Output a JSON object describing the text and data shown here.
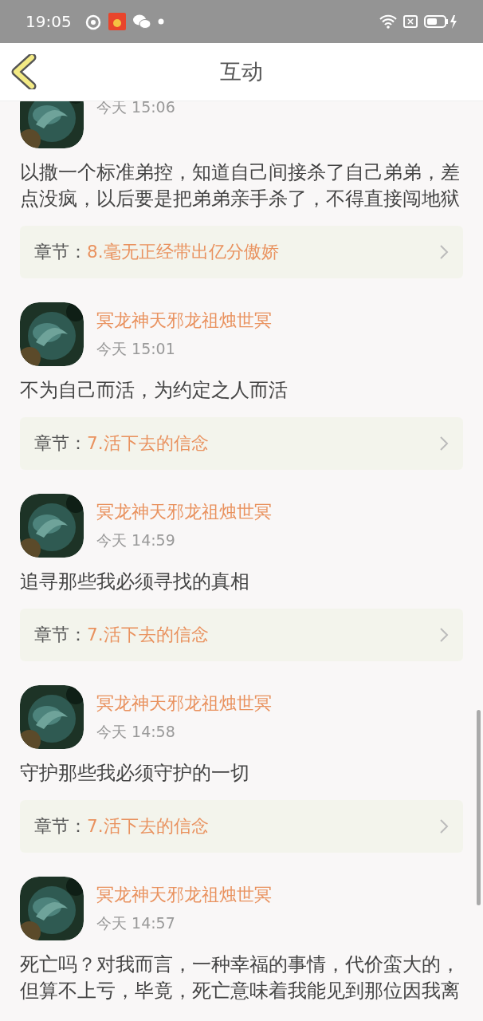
{
  "status_bar": {
    "time": "19:05"
  },
  "header": {
    "title": "互动"
  },
  "comments": [
    {
      "time": "今天 15:06",
      "text": "以撒一个标准弟控，知道自己间接杀了自己弟弟，差点没疯，以后要是把弟弟亲手杀了，不得直接闯地狱",
      "chapter_label": "章节：",
      "chapter": "8.毫无正经带出亿分傲娇"
    },
    {
      "name": "冥龙神天邪龙祖烛世冥",
      "time": "今天 15:01",
      "text": "不为自己而活，为约定之人而活",
      "chapter_label": "章节：",
      "chapter": "7.活下去的信念"
    },
    {
      "name": "冥龙神天邪龙祖烛世冥",
      "time": "今天 14:59",
      "text": "追寻那些我必须寻找的真相",
      "chapter_label": "章节：",
      "chapter": "7.活下去的信念"
    },
    {
      "name": "冥龙神天邪龙祖烛世冥",
      "time": "今天 14:58",
      "text": "守护那些我必须守护的一切",
      "chapter_label": "章节：",
      "chapter": "7.活下去的信念"
    },
    {
      "name": "冥龙神天邪龙祖烛世冥",
      "time": "今天 14:57",
      "text": "死亡吗？对我而言，一种幸福的事情，代价蛮大的，但算不上亏，毕竟，死亡意味着我能见到那位因我离"
    }
  ]
}
